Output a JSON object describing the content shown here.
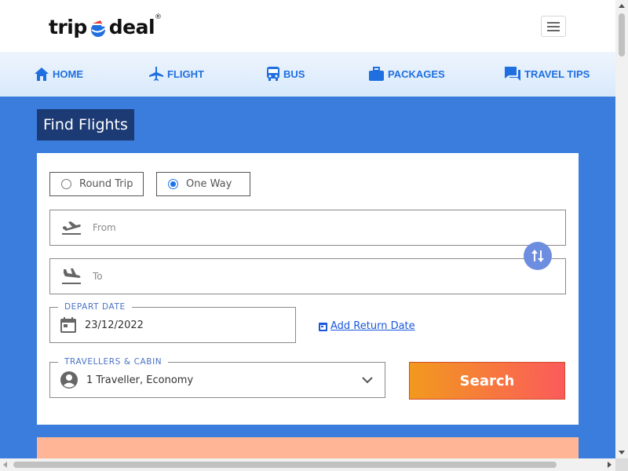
{
  "logo": {
    "part1": "trip",
    "part2": "deal",
    "mark": "®"
  },
  "nav": {
    "items": [
      {
        "label": "HOME",
        "icon": "home-icon"
      },
      {
        "label": "FLIGHT",
        "icon": "airplane-icon"
      },
      {
        "label": "BUS",
        "icon": "bus-icon"
      },
      {
        "label": "PACKAGES",
        "icon": "briefcase-icon"
      },
      {
        "label": "TRAVEL TIPS",
        "icon": "chat-icon"
      }
    ]
  },
  "colors": {
    "accent": "#1f6fe0",
    "main_bg": "#3b7ddd",
    "title_bg": "#1c3a74",
    "search_from": "#f2991e",
    "search_to": "#fb5b5b"
  },
  "search": {
    "title": "Find Flights",
    "trip_types": [
      {
        "label": "Round Trip",
        "checked": false
      },
      {
        "label": "One Way",
        "checked": true
      }
    ],
    "from_placeholder": "From",
    "to_placeholder": "To",
    "depart_legend": "DEPART DATE",
    "depart_value": "23/12/2022",
    "add_return": "Add Return Date",
    "travellers_legend": "TRAVELLERS & CABIN",
    "travellers_value": "1 Traveller, Economy",
    "search_label": "Search"
  }
}
